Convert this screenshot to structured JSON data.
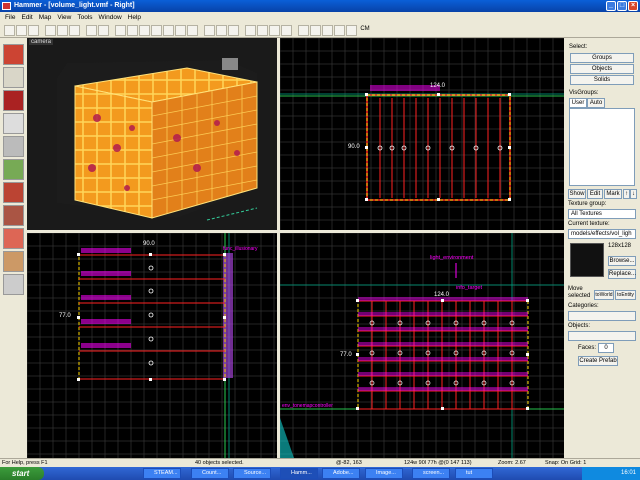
{
  "window": {
    "title": "Hammer - [volume_light.vmf - Right]"
  },
  "menu": [
    "File",
    "Edit",
    "Map",
    "View",
    "Tools",
    "Window",
    "Help"
  ],
  "toolbar": {
    "cm_label": "CM"
  },
  "viewports": {
    "camera": {
      "label": "camera"
    },
    "top": {
      "width_label": "124.0",
      "height_label": "90.0"
    },
    "side": {
      "width_label": "90.0",
      "height_label": "77.0",
      "entity_label": "func_illusionary"
    },
    "front": {
      "width_label": "124.0",
      "height_label": "77.0",
      "env_label": "light_environment",
      "target_label": "info_target",
      "tonemap_label": "env_tonemapcontroller"
    }
  },
  "right_panel": {
    "select_label": "Select:",
    "groups": "Groups",
    "objects": "Objects",
    "solids": "Solids",
    "visgroups_label": "VisGroups:",
    "tab_user": "User",
    "tab_auto": "Auto",
    "show": "Show",
    "edit": "Edit",
    "mark": "Mark",
    "texture_group_label": "Texture group:",
    "texture_group_value": "All Textures",
    "current_texture_label": "Current texture:",
    "current_texture_value": "models/effects/vol_ligh",
    "texture_size": "128x128",
    "browse": "Browse...",
    "replace": "Replace...",
    "move_selected_label": "Move selected",
    "to_world": "toWorld",
    "to_entity": "toEntity",
    "categories_label": "Categories:",
    "objects_label": "Objects:",
    "faces_label": "Faces:",
    "faces_value": "0",
    "create_prefab": "Create Prefab"
  },
  "status": {
    "help": "For Help, press F1",
    "selected": "40 objects selected.",
    "coords": "@-82, 163",
    "dims": "124w 90l 77h @(0 147 113)",
    "zoom": "Zoom: 2.67",
    "snap": "Snap: On Grid: 1"
  },
  "taskbar": {
    "start": "start",
    "tasks": [
      "STEAM...",
      "Count...",
      "Source...",
      "Hamm...",
      "Adobe...",
      "Image...",
      "screen...",
      "tut"
    ],
    "clock": "16:01"
  },
  "colors": {
    "selection": "#ff2222",
    "entity_label": "#ff00ff",
    "grid": "#3a3a3a",
    "grid_major": "#555555",
    "titlebar": "#0a5fd8"
  }
}
